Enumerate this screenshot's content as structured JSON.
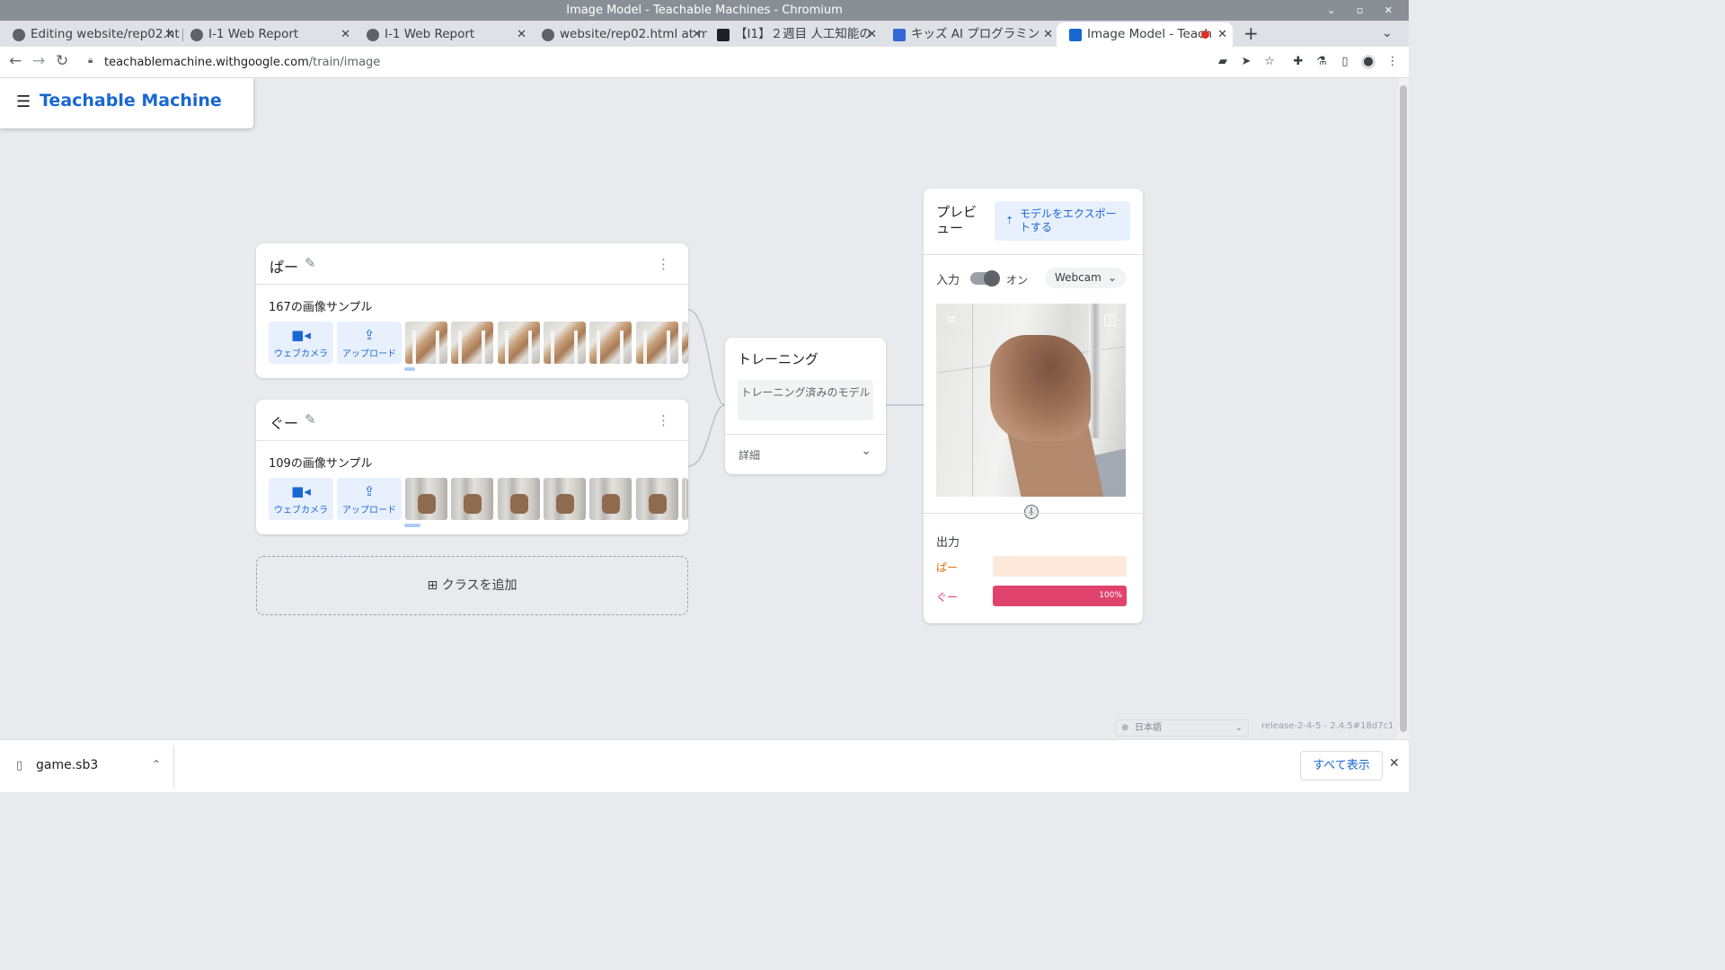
{
  "window": {
    "title": "Image Model - Teachable Machines - Chromium",
    "controls": "⌄ ▫ ✕"
  },
  "tabs": [
    {
      "title": "Editing website/rep02.ht",
      "close": "✕"
    },
    {
      "title": "I-1 Web Report",
      "close": "✕"
    },
    {
      "title": "I-1 Web Report",
      "close": "✕"
    },
    {
      "title": "website/rep02.html at m",
      "close": "✕"
    },
    {
      "title": "【I1】２週目 人工知能の",
      "close": "✕"
    },
    {
      "title": "キッズ AI プログラミン",
      "close": "✕"
    },
    {
      "title": "Image Model - Teach",
      "close": "✕"
    }
  ],
  "toolbar": {
    "url_host": "teachablemachine.withgoogle.com",
    "url_path": "/train/image"
  },
  "app": {
    "brand": "Teachable Machine",
    "menu_icon": "☰"
  },
  "classes": [
    {
      "name": "ぱー",
      "samples": "167の画像サンプル",
      "webcam_label": "ウェブカメラ",
      "upload_label": "アップロード"
    },
    {
      "name": "ぐー",
      "samples": "109の画像サンプル",
      "webcam_label": "ウェブカメラ",
      "upload_label": "アップロード"
    }
  ],
  "add_class": "⊞ クラスを追加",
  "training": {
    "title": "トレーニング",
    "button": "トレーニング済みのモデル",
    "advanced": "詳細"
  },
  "preview": {
    "title": "プレビュー",
    "export": "モデルをエクスポートする",
    "input_label": "入力",
    "toggle_state": "オン",
    "source": "Webcam",
    "output_label": "出力",
    "outputs": [
      {
        "label": "ぱー",
        "value": 0,
        "color": "#e8710a",
        "track": "#fde8dc"
      },
      {
        "label": "ぐー",
        "value": 100,
        "value_text": "100%",
        "color": "#e0426e",
        "track": "#fadbe4"
      }
    ]
  },
  "footer": {
    "language": "日本語",
    "release": "release-2-4-5 - 2.4.5#18d7c1"
  },
  "downloads": {
    "file": "game.sb3",
    "show_all": "すべて表示"
  }
}
